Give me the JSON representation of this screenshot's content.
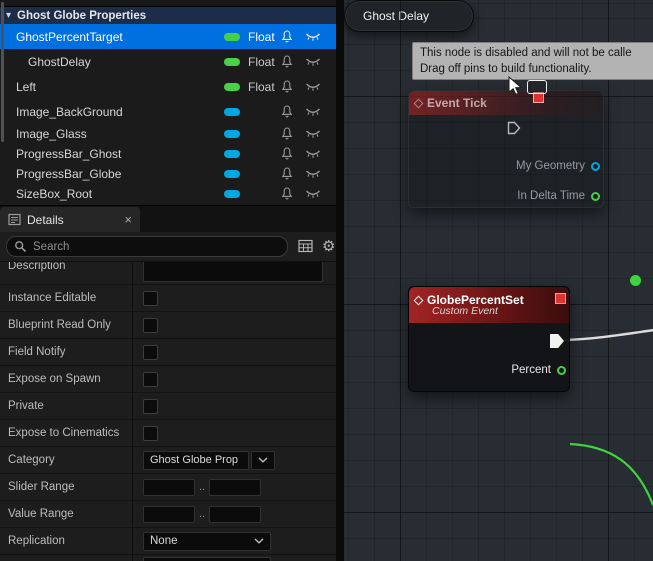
{
  "blueprint": {
    "category_header": "Ghost Globe Properties",
    "variables": [
      {
        "name": "GhostPercentTarget",
        "type_label": "Float",
        "pin_color": "green",
        "selected": true
      },
      {
        "name": "GhostDelay",
        "type_label": "Float",
        "pin_color": "green"
      },
      {
        "name": "Left",
        "type_label": "Float",
        "pin_color": "green"
      },
      {
        "name": "Image_BackGround",
        "type_label": "",
        "pin_color": "blue"
      },
      {
        "name": "Image_Glass",
        "type_label": "",
        "pin_color": "blue"
      },
      {
        "name": "ProgressBar_Ghost",
        "type_label": "",
        "pin_color": "blue"
      },
      {
        "name": "ProgressBar_Globe",
        "type_label": "",
        "pin_color": "blue"
      },
      {
        "name": "SizeBox_Root",
        "type_label": "",
        "pin_color": "blue"
      }
    ]
  },
  "details": {
    "tab_title": "Details",
    "close_label": "×",
    "search_placeholder": "Search",
    "partial_row_label": "Description",
    "rows": {
      "instance_editable": "Instance Editable",
      "blueprint_read_only": "Blueprint Read Only",
      "field_notify": "Field Notify",
      "expose_on_spawn": "Expose on Spawn",
      "private": "Private",
      "expose_to_cinematics": "Expose to Cinematics",
      "category_label": "Category",
      "category_value": "Ghost Globe Prop",
      "slider_range_label": "Slider Range",
      "range_separator": "..",
      "value_range_label": "Value Range",
      "replication_label": "Replication",
      "replication_value": "None"
    }
  },
  "graph": {
    "tooltip_line1": "This node is disabled and will not be calle",
    "tooltip_line2": "Drag off pins to build functionality.",
    "event_tick": {
      "title": "Event Tick",
      "pin1": "My Geometry",
      "pin2": "In Delta Time"
    },
    "custom_event": {
      "title": "GlobePercentSet",
      "subtitle": "Custom Event",
      "pin": "Percent"
    },
    "variable_get": {
      "label": "Ghost Delay"
    }
  },
  "colors": {
    "selection_blue": "#0070e0",
    "float_green": "#47d147",
    "object_blue": "#00a7e1",
    "event_red": "#a32424",
    "wire_white": "#dcdcdc",
    "wire_green": "#3fd43f",
    "disabled_badge_red": "#e03030"
  }
}
